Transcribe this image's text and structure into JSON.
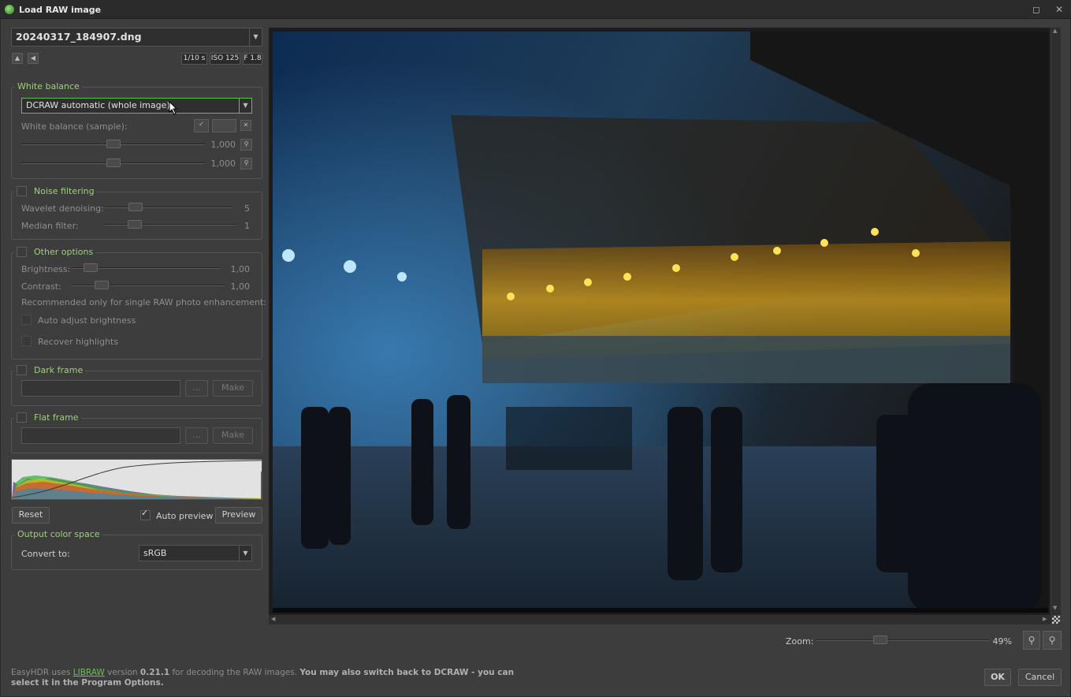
{
  "window": {
    "title": "Load RAW image",
    "maximize_icon": "maximize-icon",
    "close_icon": "close-icon"
  },
  "file": {
    "selected": "20240317_184907.dng"
  },
  "exif": {
    "shutter": "1/10 s",
    "iso": "ISO 125",
    "aperture": "F 1.8"
  },
  "white_balance": {
    "title": "White balance",
    "mode": "DCRAW automatic (whole image)",
    "sample_label": "White balance (sample):",
    "slider1_value": "1,000",
    "slider1_level": 0.5,
    "slider2_value": "1,000",
    "slider2_level": 0.5
  },
  "noise": {
    "title": "Noise filtering",
    "checked": false,
    "wavelet_label": "Wavelet denoising:",
    "wavelet_value": "5",
    "median_label": "Median filter:",
    "median_value": "1"
  },
  "other": {
    "title": "Other options",
    "checked": false,
    "brightness_label": "Brightness:",
    "brightness_value": "1,00",
    "contrast_label": "Contrast:",
    "contrast_value": "1,00",
    "note": "Recommended only for single RAW photo enhancement:",
    "auto_adjust_label": "Auto adjust brightness",
    "recover_label": "Recover highlights"
  },
  "dark_frame": {
    "title": "Dark frame",
    "browse": "...",
    "make": "Make"
  },
  "flat_frame": {
    "title": "Flat frame",
    "browse": "...",
    "make": "Make"
  },
  "actions": {
    "reset": "Reset",
    "auto_preview": "Auto preview",
    "auto_preview_checked": true,
    "preview": "Preview"
  },
  "output": {
    "title": "Output color space",
    "convert_label": "Convert to:",
    "convert_value": "sRGB"
  },
  "zoom": {
    "label": "Zoom:",
    "value": "49%",
    "level": 0.49
  },
  "footer": {
    "text1": "EasyHDR uses ",
    "link": "LIBRAW",
    "text2": " version ",
    "version": "0.21.1",
    "text3": " for decoding the RAW images. ",
    "bold": "You may also switch back to DCRAW - you can select it in the Program Options."
  },
  "buttons": {
    "ok": "OK",
    "cancel": "Cancel"
  },
  "colors": {
    "accent": "#9fd07a",
    "focus_border": "#5fbf50"
  }
}
